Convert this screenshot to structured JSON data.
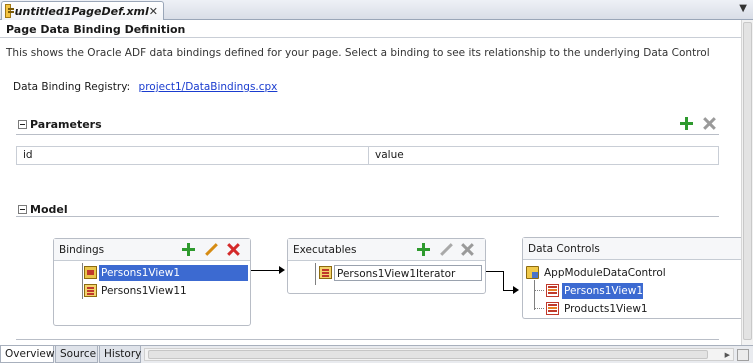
{
  "editor_tab": {
    "title": "untitled1PageDef.xml"
  },
  "page": {
    "title": "Page Data Binding Definition",
    "description": "This shows the Oracle ADF data bindings defined for your page. Select a binding to see its relationship to the underlying Data Control",
    "registry_label": "Data Binding Registry:",
    "registry_link": "project1/DataBindings.cpx"
  },
  "parameters": {
    "label": "Parameters",
    "columns": [
      "id",
      "value"
    ]
  },
  "model": {
    "label": "Model",
    "bindings": {
      "label": "Bindings",
      "items": [
        "Persons1View1",
        "Persons1View11"
      ]
    },
    "executables": {
      "label": "Executables",
      "items": [
        "Persons1View1Iterator"
      ]
    },
    "data_controls": {
      "label": "Data Controls",
      "root": "AppModuleDataControl",
      "items": [
        "Persons1View1",
        "Products1View1"
      ]
    }
  },
  "bottom_tabs": [
    "Overview",
    "Source",
    "History"
  ],
  "colors": {
    "selection": "#3c6ad1",
    "link": "#1a3ccf",
    "add": "#2e9a2e",
    "delete": "#d42a2a"
  }
}
